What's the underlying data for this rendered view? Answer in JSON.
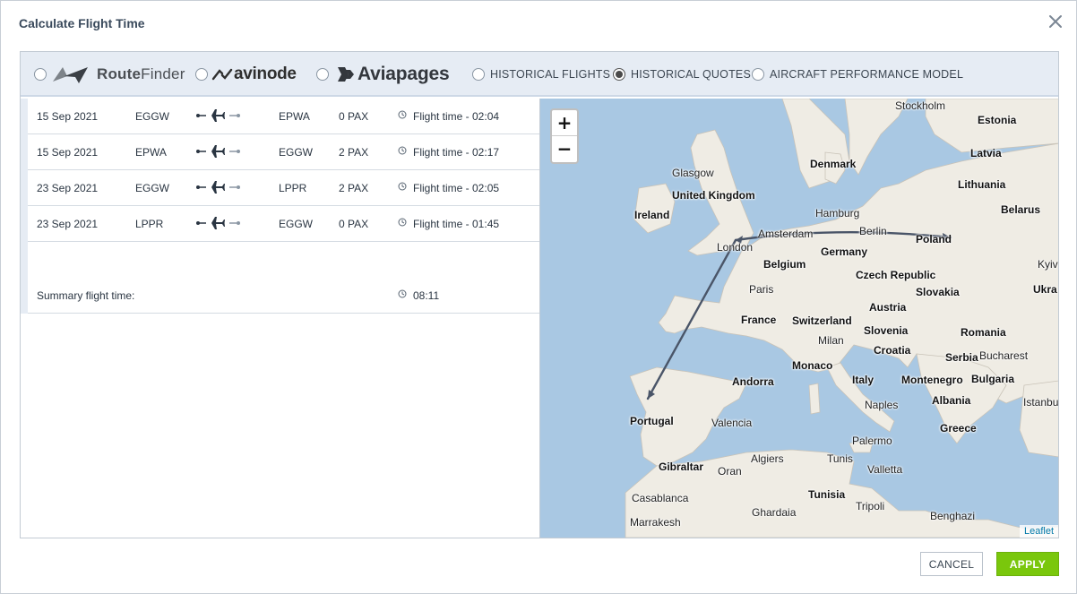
{
  "dialog": {
    "title": "Calculate Flight Time"
  },
  "sources": {
    "routefinder": {
      "brand_a": "Route",
      "brand_b": "Finder",
      "selected": false
    },
    "avinode": {
      "brand": "avinode",
      "selected": false
    },
    "aviapages": {
      "brand": "Aviapages",
      "selected": false
    },
    "historical_flights": {
      "label": "HISTORICAL FLIGHTS",
      "selected": false
    },
    "historical_quotes": {
      "label": "HISTORICAL QUOTES",
      "selected": true
    },
    "aircraft_performance": {
      "label": "AIRCRAFT PERFORMANCE MODEL",
      "selected": false
    }
  },
  "legs": [
    {
      "date": "15 Sep 2021",
      "from": "EGGW",
      "to": "EPWA",
      "pax": "0 PAX",
      "time": "Flight time - 02:04"
    },
    {
      "date": "15 Sep 2021",
      "from": "EPWA",
      "to": "EGGW",
      "pax": "2 PAX",
      "time": "Flight time - 02:17"
    },
    {
      "date": "23 Sep 2021",
      "from": "EGGW",
      "to": "LPPR",
      "pax": "2 PAX",
      "time": "Flight time - 02:05"
    },
    {
      "date": "23 Sep 2021",
      "from": "LPPR",
      "to": "EGGW",
      "pax": "0 PAX",
      "time": "Flight time - 01:45"
    }
  ],
  "summary": {
    "label": "Summary flight time:",
    "value": "08:11"
  },
  "map": {
    "zoom_in": "+",
    "zoom_out": "−",
    "attribution": "Leaflet",
    "labels": {
      "stockholm": "Stockholm",
      "estonia": "Estonia",
      "latvia": "Latvia",
      "denmark": "Denmark",
      "glasgow": "Glasgow",
      "uk": "United Kingdom",
      "lithuania": "Lithuania",
      "ireland": "Ireland",
      "hamburg": "Hamburg",
      "belarus": "Belarus",
      "amsterdam": "Amsterdam",
      "berlin": "Berlin",
      "london": "London",
      "poland": "Poland",
      "germany": "Germany",
      "belgium": "Belgium",
      "kyiv": "Kyiv",
      "czech": "Czech Republic",
      "paris": "Paris",
      "slovakia": "Slovakia",
      "ukraine": "Ukra",
      "austria": "Austria",
      "france": "France",
      "switzerland": "Switzerland",
      "slovenia": "Slovenia",
      "milan": "Milan",
      "romania": "Romania",
      "croatia": "Croatia",
      "monaco": "Monaco",
      "serbia": "Serbia",
      "bucharest": "Bucharest",
      "andorra": "Andorra",
      "italy": "Italy",
      "montenegro": "Montenegro",
      "bulgaria": "Bulgaria",
      "albania": "Albania",
      "istanbul": "Istanbul",
      "naples": "Naples",
      "portugal": "Portugal",
      "valencia": "Valencia",
      "greece": "Greece",
      "palermo": "Palermo",
      "gibraltar": "Gibraltar",
      "algiers": "Algiers",
      "tunis": "Tunis",
      "valletta": "Valletta",
      "oran": "Oran",
      "casablanca": "Casablanca",
      "tunisia": "Tunisia",
      "ghardaia": "Ghardaia",
      "tripoli": "Tripoli",
      "marrakesh": "Marrakesh",
      "benghazi": "Benghazi"
    }
  },
  "footer": {
    "cancel": "CANCEL",
    "apply": "APPLY"
  },
  "colors": {
    "apply": "#7ac70c",
    "route": "#4a5568",
    "sea": "#a9c8e3",
    "land": "#efece4"
  }
}
